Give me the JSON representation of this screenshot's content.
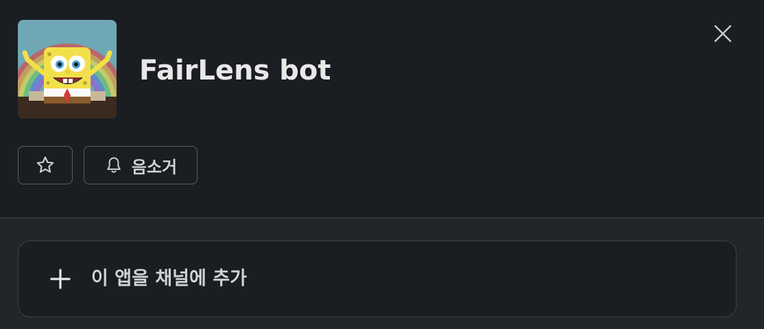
{
  "app": {
    "name": "FairLens bot",
    "avatar": "spongebob-imagination-avatar"
  },
  "header": {
    "close_icon": "close-icon"
  },
  "actions": {
    "star_icon": "star-icon",
    "mute_icon": "bell-icon",
    "mute_label": "음소거"
  },
  "add_to_channel": {
    "icon": "plus-icon",
    "label": "이 앱을 채널에 추가"
  },
  "colors": {
    "background": "#1a1d21",
    "lower_background": "#222529",
    "text": "#d1d2d3",
    "title": "#e8e8e8",
    "border": "#5e6063"
  }
}
